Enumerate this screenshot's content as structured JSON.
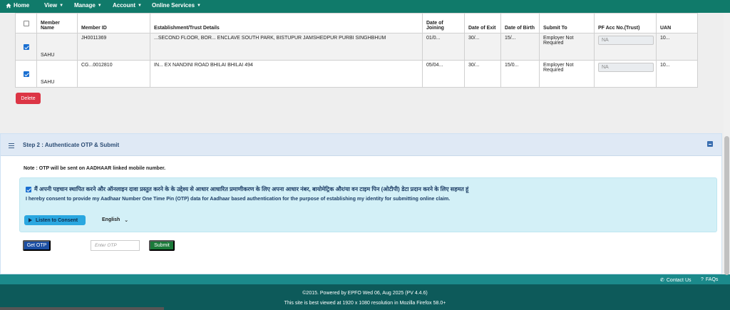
{
  "nav": {
    "home": "Home",
    "view": "View",
    "manage": "Manage",
    "account": "Account",
    "online_services": "Online Services"
  },
  "table": {
    "headers": {
      "member_name": "Member Name",
      "member_id": "Member ID",
      "establishment": "Establishment/Trust Details",
      "doj": "Date of Joining",
      "doe": "Date of Exit",
      "dob": "Date of Birth",
      "submit_to": "Submit To",
      "pf_acc": "PF Acc No.(Trust)",
      "uan": "UAN"
    },
    "rows": [
      {
        "checked": true,
        "name": "SAHU",
        "member_id": "JH0011369",
        "establishment": "...SECOND FLOOR, BOR... ENCLAVE SOUTH PARK, BISTUPUR JAMSHEDPUR PURBI SINGHBHUM",
        "doj": "01/0...",
        "doe": "30/...",
        "dob": "15/...",
        "submit_to": "Employer Not Required",
        "pf_placeholder": "NA",
        "uan": "10..."
      },
      {
        "checked": true,
        "name": "SAHU",
        "member_id": "CG...0012810",
        "establishment": "IN... EX NANDINI ROAD BHILAI BHILAI 494",
        "doj": "05/04...",
        "doe": "30/...",
        "dob": "15/0...",
        "submit_to": "Employer Not Required",
        "pf_placeholder": "NA",
        "uan": "10..."
      }
    ]
  },
  "delete_label": "Delete",
  "step2": {
    "title": "Step 2 : Authenticate OTP & Submit",
    "note": "Note : OTP will be sent on AADHAAR linked mobile number.",
    "consent_hindi": "मैं अपनी पहचान स्थापित करने और ऑनलाइन दावा प्रस्तुत करने के के उद्देश्य से आधार आधारित प्रमाणीकरण के लिए अपना आधार नंबर, बायोमेट्रिक और/या वन टाइम पिन (ओटीपी) डेटा प्रदान करने के लिए सहमत हूं",
    "consent_en": "I hereby consent to provide my Aadhaar Number One Time Pin (OTP) data for Aadhaar based authentication for the purpose of establishing my identity for submitting online claim.",
    "listen_label": "Listen to Consent",
    "language": "English",
    "get_otp_label": "Get OTP",
    "otp_placeholder": "Enter OTP",
    "submit_label": "Submit"
  },
  "footer": {
    "contact": "Contact Us",
    "faqs": "FAQs",
    "powered": "©2015. Powered by EPFO Wed 06, Aug 2025 (PV 4.4.6)",
    "best_viewed": "This site is best viewed at 1920 x 1080 resolution in Mozilla Firefox 58.0+"
  }
}
